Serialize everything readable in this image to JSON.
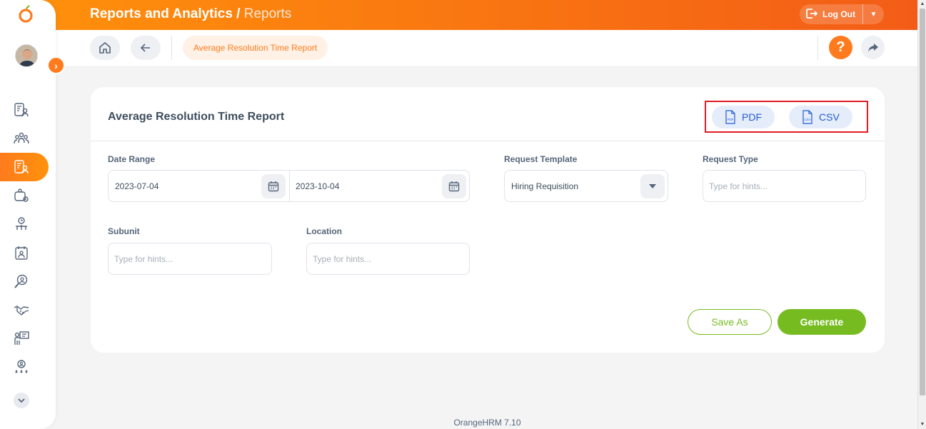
{
  "header": {
    "module": "Reports and Analytics",
    "separator": " / ",
    "section": "Reports",
    "logout_label": "Log Out"
  },
  "breadcrumb": {
    "current": "Average Resolution Time Report"
  },
  "card": {
    "title": "Average Resolution Time Report",
    "export_pdf_label": "PDF",
    "export_csv_label": "CSV",
    "pdf_icon_text": "PDF",
    "csv_icon_text": "CSV"
  },
  "form": {
    "date_range_label": "Date Range",
    "date_from": "2023-07-04",
    "date_to": "2023-10-04",
    "request_template_label": "Request Template",
    "request_template_value": "Hiring Requisition",
    "request_type_label": "Request Type",
    "request_type_placeholder": "Type for hints...",
    "subunit_label": "Subunit",
    "subunit_placeholder": "Type for hints...",
    "location_label": "Location",
    "location_placeholder": "Type for hints..."
  },
  "actions": {
    "save_as_label": "Save As",
    "generate_label": "Generate"
  },
  "footer": {
    "version": "OrangeHRM 7.10"
  },
  "sidebar": {
    "items": [
      "people-directory-icon",
      "team-icon",
      "reports-icon",
      "settings-group-icon",
      "time-org-icon",
      "calendar-person-icon",
      "recruitment-search-icon",
      "handshake-icon",
      "training-icon",
      "performance-award-icon"
    ],
    "active_index": 2
  },
  "colors": {
    "brand_orange": "#ff7b1d",
    "header_gradient_start": "#ff920b",
    "header_gradient_end": "#f35c17",
    "accent_green": "#76bc21",
    "export_blue": "#1f5bd7",
    "highlight_red": "#e01b24"
  }
}
